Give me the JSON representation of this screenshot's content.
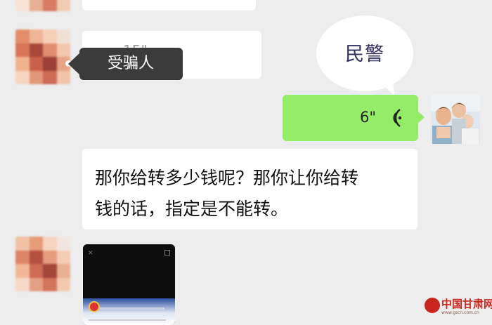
{
  "speech_label": "民警",
  "scammed_label": "受骗人",
  "faint_voice_duration": "15\"",
  "voice_message": {
    "duration": "6\""
  },
  "text_message": {
    "line1": "那你给转多少钱呢？那你让你给转",
    "line2": "钱的话，指定是不能转。"
  },
  "watermark": {
    "name": "中国甘肃网",
    "url": "www.gscn.com.cn"
  },
  "colors": {
    "chat_bg": "#ededed",
    "green_bubble": "#95ec69",
    "callout": "#3b3b3b",
    "watermark": "#c8261f"
  }
}
